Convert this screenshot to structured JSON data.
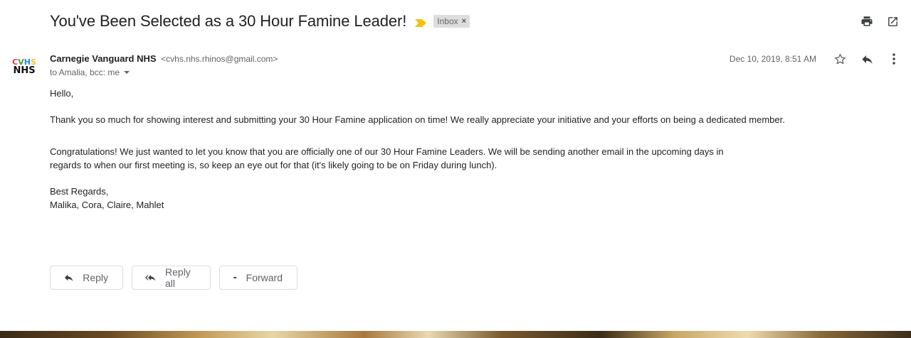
{
  "email": {
    "subject": "You've Been Selected as a 30 Hour Famine Leader!",
    "label": "Inbox",
    "label_remove": "×",
    "sender_name": "Carnegie Vanguard NHS",
    "sender_email": "<cvhs.nhs.rhinos@gmail.com>",
    "recipients": "to Amalia, bcc: me",
    "date": "Dec 10, 2019, 8:51 AM",
    "avatar": {
      "line1": "CVHS",
      "line2": "NHS"
    },
    "body": {
      "greeting": "Hello,",
      "p1": "Thank you so much for showing interest and submitting your 30 Hour Famine application on time! We really appreciate your initiative and your efforts on being a dedicated member.",
      "p2_line1": "Congratulations! We just wanted to let you know that you are officially one of our 30 Hour Famine Leaders. We will be sending another email in the upcoming days in",
      "p2_line2": "regards to when our first meeting is, so keep an eye out for that (it's likely going to be on Friday during lunch).",
      "closing": "Best Regards,",
      "signature": "Malika, Cora, Claire, Mahlet"
    }
  },
  "actions": {
    "reply": "Reply",
    "reply_all": "Reply all",
    "forward": "Forward"
  },
  "icons": {
    "importance": "importance-marker-icon",
    "print": "print-icon",
    "new_window": "open-in-new-window-icon",
    "star": "star-icon",
    "reply": "reply-icon",
    "more": "more-vert-icon"
  },
  "colors": {
    "importance": "#f4c20d",
    "avatar_c": "#e53935",
    "avatar_v": "#43a047",
    "avatar_h": "#1e88e5",
    "avatar_s": "#fbc02d"
  }
}
